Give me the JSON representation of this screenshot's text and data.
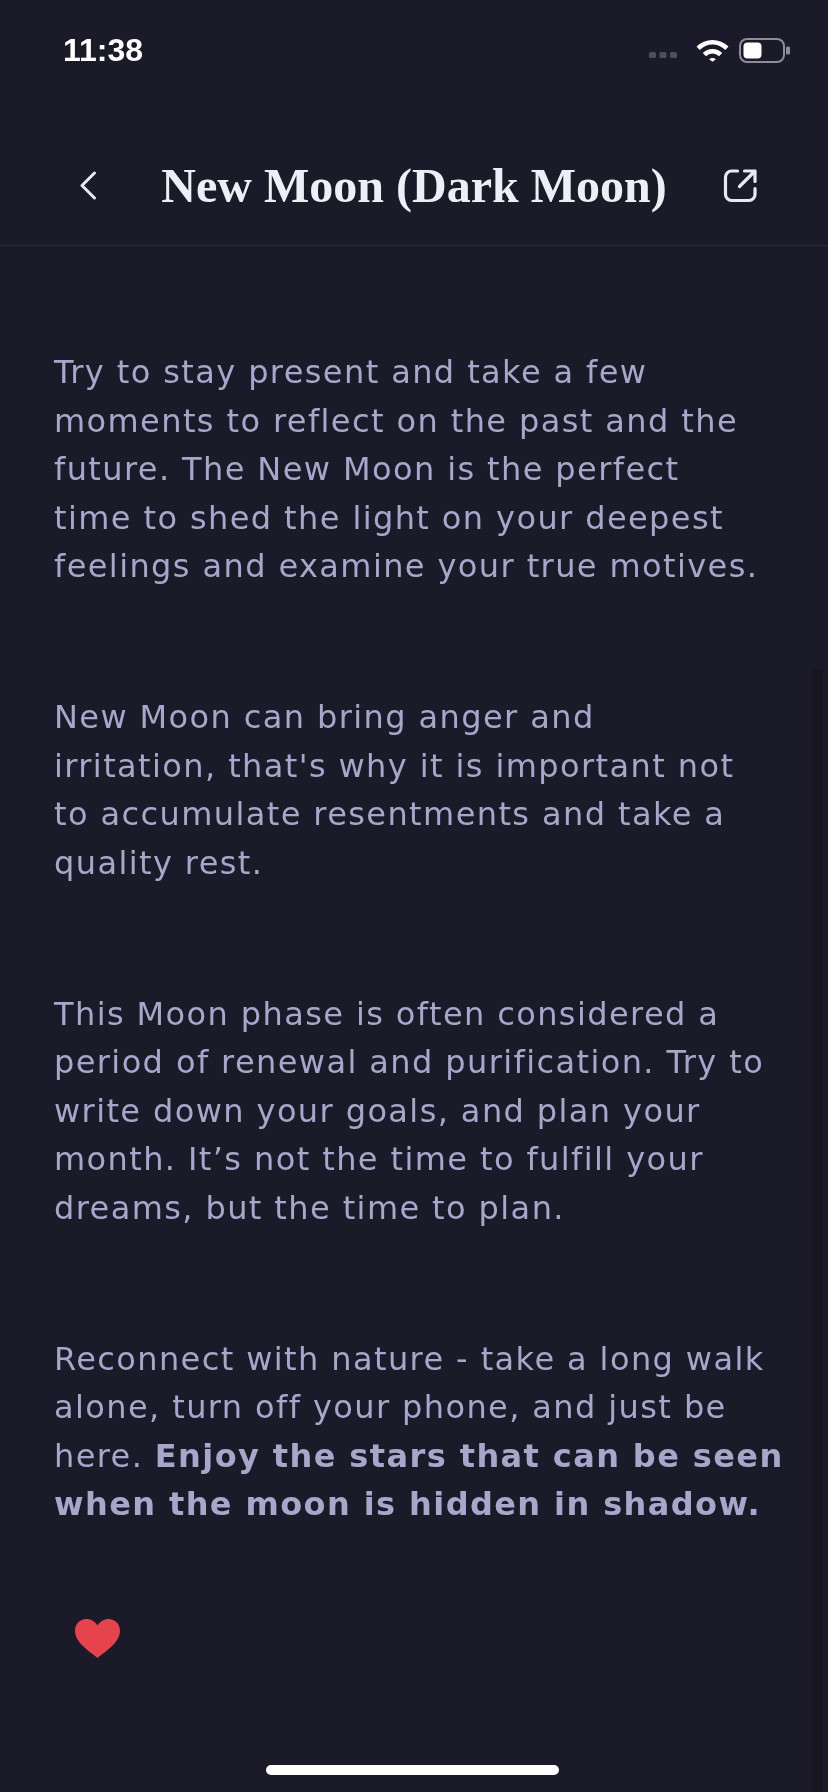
{
  "status_bar": {
    "time": "11:38"
  },
  "header": {
    "title": "New Moon (Dark Moon)"
  },
  "paragraphs": [
    "Try to stay present and take a few moments to reflect on the past and the future. The New Moon is the perfect time to shed the light on your deepest feelings and examine your true motives.",
    "New Moon can bring anger and irritation, that's why it is important not to accumulate resentments and take a quality rest.",
    "This Moon phase is often considered a period of renewal and purification. Try to write down your goals, and plan your month. It’s not the time to fulfill your dreams, but the time to plan.",
    "Reconnect with nature - take a long walk alone, turn off your phone, and just be here. **Enjoy the stars that can be seen when the moon is hidden in shadow.**"
  ],
  "favorite": {
    "on": true
  }
}
